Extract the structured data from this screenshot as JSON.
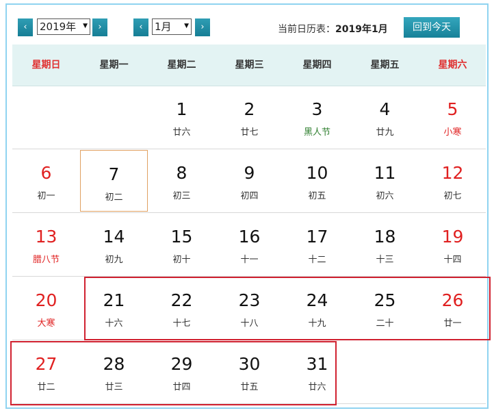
{
  "toolbar": {
    "prev_year": "‹",
    "next_year": "›",
    "year_value": "2019年",
    "prev_month": "‹",
    "next_month": "›",
    "month_value": "1月",
    "current_label": "当前日历表：",
    "current_value": "2019年1月",
    "today_button": "回到今天"
  },
  "weekdays": [
    "星期日",
    "星期一",
    "星期二",
    "星期三",
    "星期四",
    "星期五",
    "星期六"
  ],
  "weeks": [
    [
      {
        "d": "",
        "l": ""
      },
      {
        "d": "",
        "l": ""
      },
      {
        "d": "1",
        "l": "廿六"
      },
      {
        "d": "2",
        "l": "廿七"
      },
      {
        "d": "3",
        "l": "黑人节"
      },
      {
        "d": "4",
        "l": "廿九"
      },
      {
        "d": "5",
        "l": "小寒"
      }
    ],
    [
      {
        "d": "6",
        "l": "初一"
      },
      {
        "d": "7",
        "l": "初二"
      },
      {
        "d": "8",
        "l": "初三"
      },
      {
        "d": "9",
        "l": "初四"
      },
      {
        "d": "10",
        "l": "初五"
      },
      {
        "d": "11",
        "l": "初六"
      },
      {
        "d": "12",
        "l": "初七"
      }
    ],
    [
      {
        "d": "13",
        "l": "腊八节"
      },
      {
        "d": "14",
        "l": "初九"
      },
      {
        "d": "15",
        "l": "初十"
      },
      {
        "d": "16",
        "l": "十一"
      },
      {
        "d": "17",
        "l": "十二"
      },
      {
        "d": "18",
        "l": "十三"
      },
      {
        "d": "19",
        "l": "十四"
      }
    ],
    [
      {
        "d": "20",
        "l": "大寒"
      },
      {
        "d": "21",
        "l": "十六"
      },
      {
        "d": "22",
        "l": "十七"
      },
      {
        "d": "23",
        "l": "十八"
      },
      {
        "d": "24",
        "l": "十九"
      },
      {
        "d": "25",
        "l": "二十"
      },
      {
        "d": "26",
        "l": "廿一"
      }
    ],
    [
      {
        "d": "27",
        "l": "廿二"
      },
      {
        "d": "28",
        "l": "廿三"
      },
      {
        "d": "29",
        "l": "廿四"
      },
      {
        "d": "30",
        "l": "廿五"
      },
      {
        "d": "31",
        "l": "廿六"
      },
      {
        "d": "",
        "l": ""
      },
      {
        "d": "",
        "l": ""
      }
    ]
  ],
  "colors": {
    "accent": "#178198",
    "weekend": "#e02020",
    "festival_green": "#2f7f2f",
    "highlight_box": "#d0202f",
    "today_border": "#e0a060"
  }
}
